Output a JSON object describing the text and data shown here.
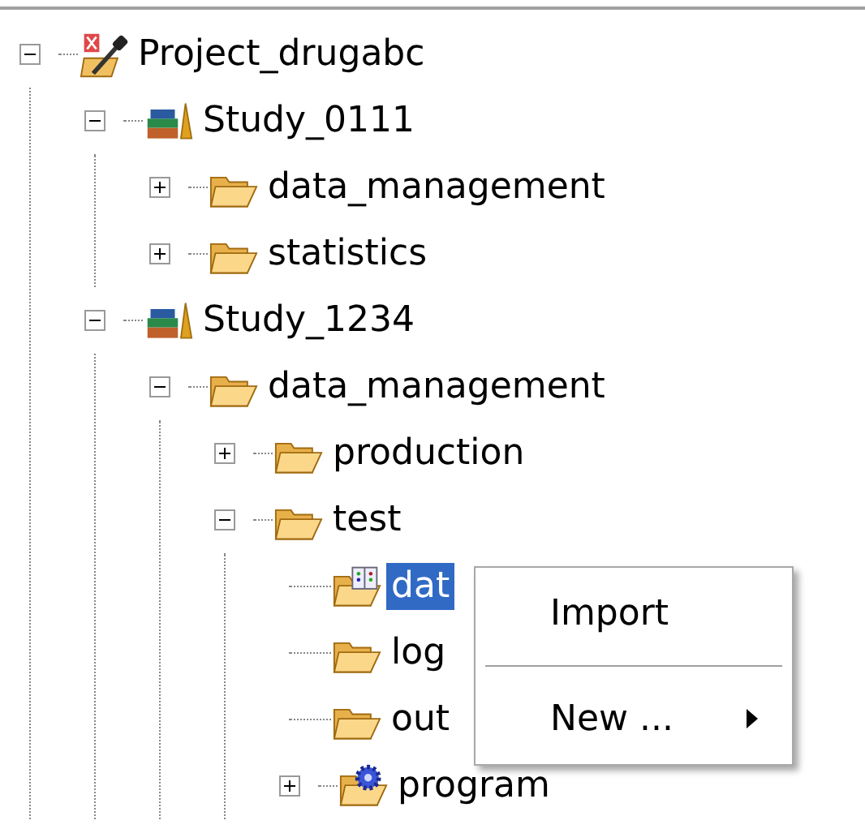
{
  "tree": [
    {
      "label": "Project_drugabc",
      "kind": "project",
      "expanded": true,
      "selected": false,
      "children": [
        {
          "label": "Study_0111",
          "kind": "study",
          "expanded": true,
          "selected": false,
          "children": [
            {
              "label": "data_management",
              "kind": "folder",
              "expanded": false,
              "selected": false
            },
            {
              "label": "statistics",
              "kind": "folder",
              "expanded": false,
              "selected": false
            }
          ]
        },
        {
          "label": "Study_1234",
          "kind": "study",
          "expanded": true,
          "selected": false,
          "children": [
            {
              "label": "data_management",
              "kind": "folder",
              "expanded": true,
              "selected": false,
              "children": [
                {
                  "label": "production",
                  "kind": "folder",
                  "expanded": false,
                  "selected": false
                },
                {
                  "label": "test",
                  "kind": "folder",
                  "expanded": true,
                  "selected": false,
                  "children": [
                    {
                      "label": "dat",
                      "kind": "data-folder",
                      "selected": true
                    },
                    {
                      "label": "log",
                      "kind": "folder",
                      "selected": false
                    },
                    {
                      "label": "out",
                      "kind": "folder",
                      "selected": false
                    },
                    {
                      "label": "program",
                      "kind": "program-folder",
                      "expanded": false,
                      "selected": false
                    }
                  ]
                }
              ]
            }
          ]
        }
      ]
    }
  ],
  "context_menu": [
    {
      "kind": "item",
      "label": "Import"
    },
    {
      "kind": "separator"
    },
    {
      "kind": "submenu",
      "label": "New ..."
    }
  ]
}
